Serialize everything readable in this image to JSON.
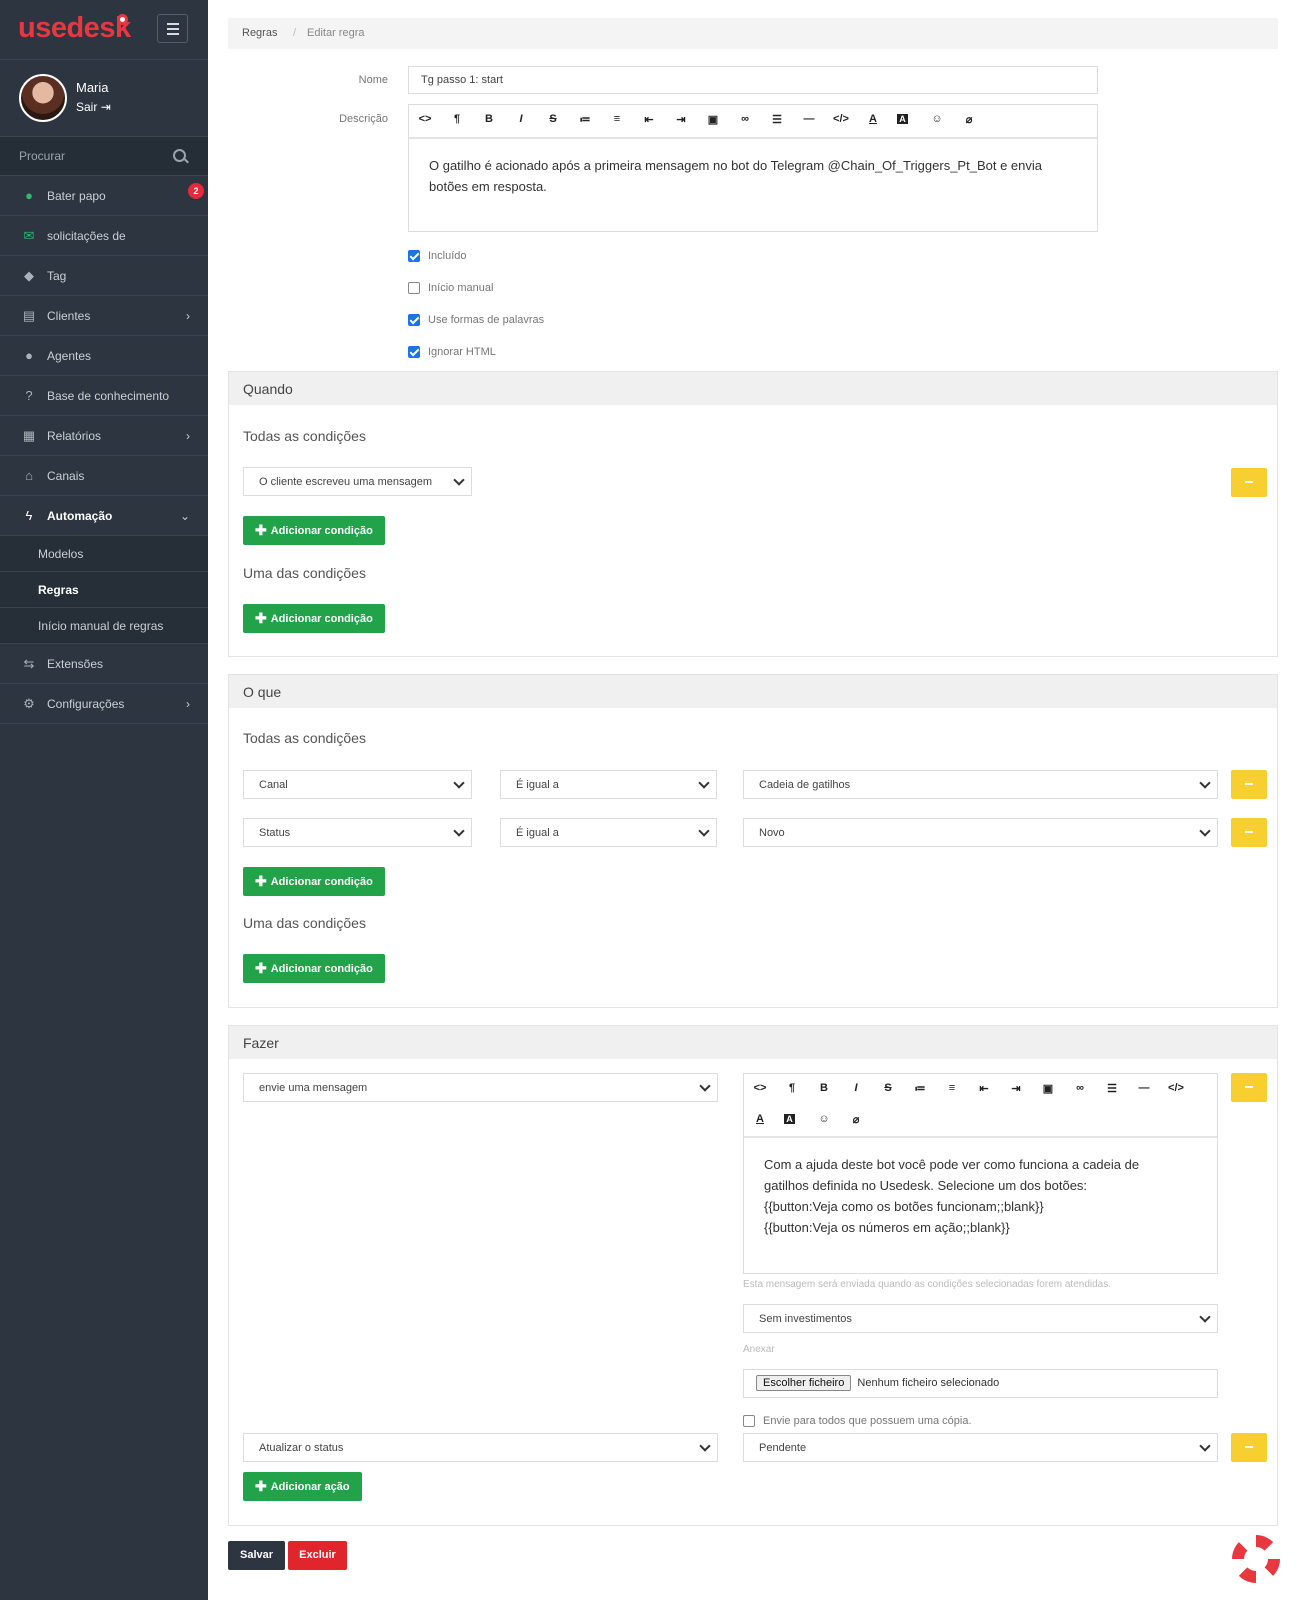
{
  "app": {
    "logo": "usedesk"
  },
  "user": {
    "name": "Maria",
    "logout": "Sair"
  },
  "sidebar": {
    "search_placeholder": "Procurar",
    "items": [
      {
        "label": "Bater papo",
        "badge": "2"
      },
      {
        "label": "solicitações de"
      },
      {
        "label": "Tag"
      },
      {
        "label": "Clientes"
      },
      {
        "label": "Agentes"
      },
      {
        "label": "Base de conhecimento"
      },
      {
        "label": "Relatórios"
      },
      {
        "label": "Canais"
      },
      {
        "label": "Automação"
      },
      {
        "label": "Extensões"
      },
      {
        "label": "Configurações"
      }
    ],
    "subitems": [
      {
        "label": "Modelos"
      },
      {
        "label": "Regras"
      },
      {
        "label": "Início manual de regras"
      }
    ]
  },
  "breadcrumb": {
    "root": "Regras",
    "sep": "/",
    "current": "Editar regra"
  },
  "form": {
    "name_label": "Nome",
    "name_value": "Tg passo 1: start",
    "description_label": "Descrição",
    "description_line1": "O gatilho é acionado após a primeira mensagem no bot do Telegram @Chain_Of_Triggers_Pt_Bot e envia",
    "description_line2": "botões em resposta.",
    "checkboxes": [
      {
        "label": "Incluído",
        "checked": true
      },
      {
        "label": "Início manual",
        "checked": false
      },
      {
        "label": "Use formas de palavras",
        "checked": true
      },
      {
        "label": "Ignorar HTML",
        "checked": true
      }
    ]
  },
  "quando": {
    "title": "Quando",
    "all_conditions": "Todas as condições",
    "condition_select": "O cliente escreveu uma mensagem",
    "add_condition": "Adicionar condição",
    "any_conditions": "Uma das condições"
  },
  "oque": {
    "title": "O que",
    "all_conditions": "Todas as condições",
    "rows": [
      {
        "field": "Canal",
        "op": "É igual a",
        "value": "Cadeia de gatilhos"
      },
      {
        "field": "Status",
        "op": "É igual a",
        "value": "Novo"
      }
    ],
    "add_condition": "Adicionar condição",
    "any_conditions": "Uma das condições"
  },
  "fazer": {
    "title": "Fazer",
    "action1": "envie uma mensagem",
    "message_lines": [
      "Com a ajuda deste bot você pode ver como funciona a cadeia de",
      "gatilhos definida no Usedesk. Selecione um dos botões:",
      "{{button:Veja como os botões funcionam;;blank}}",
      "{{button:Veja os números em ação;;blank}}"
    ],
    "help_text": "Esta mensagem será enviada quando as condições selecionadas forem atendidas.",
    "template_select": "Sem investimentos",
    "attach_label": "Anexar",
    "file_button": "Escolher ficheiro",
    "file_none": "Nenhum ficheiro selecionado",
    "copy_checkbox": "Envie para todos que possuem uma cópia.",
    "action2": "Atualizar o status",
    "action2_value": "Pendente",
    "add_action": "Adicionar ação"
  },
  "actions": {
    "save": "Salvar",
    "delete": "Excluir"
  }
}
